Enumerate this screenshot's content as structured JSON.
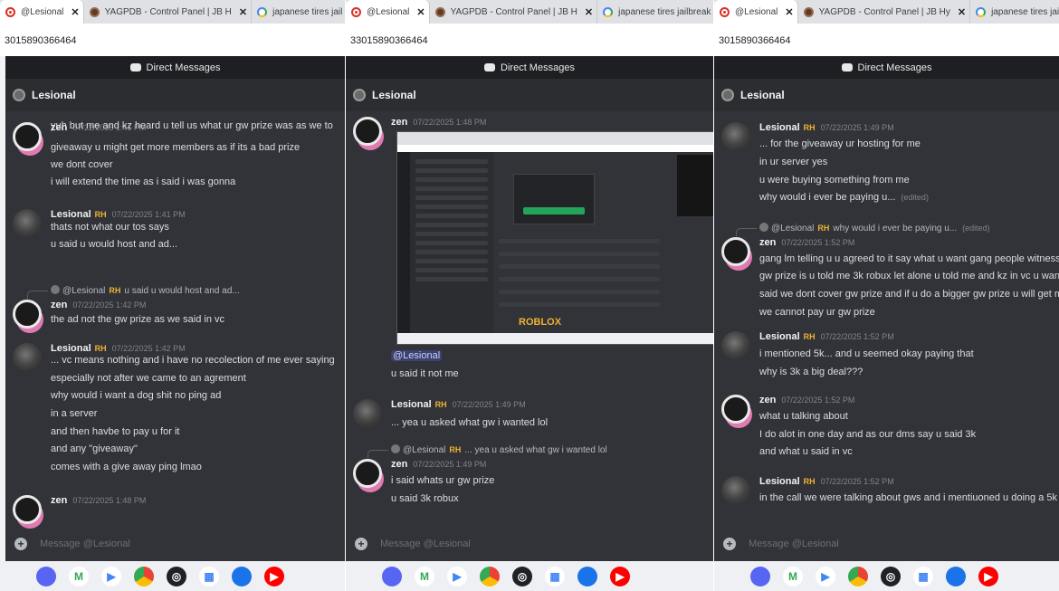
{
  "panels": [
    {
      "tabs": [
        "@Lesional",
        "YAGPDB - Control Panel | JB H",
        "japanese tires jail"
      ],
      "url": "3015890366464",
      "header": "Direct Messages",
      "channel": "Lesional",
      "messages": [
        {
          "user": "zen",
          "ts": "07/22/2025 1:41 PM",
          "lines": [
            "yuh but me and kz heard u tell us what ur gw prize was as we to",
            "giveaway u might get more members as if its a bad prize",
            "we dont cover",
            "i will extend the time as i said i was gonna"
          ]
        },
        {
          "user": "Lesional",
          "badge": "RH",
          "ts": "07/22/2025 1:41 PM",
          "lines": [
            "thats not what our tos says",
            "u said u would host and ad..."
          ]
        },
        {
          "reply": {
            "user": "@Lesional",
            "badge": "RH",
            "text": "u said u would host and ad..."
          },
          "user": "zen",
          "ts": "07/22/2025 1:42 PM",
          "lines": [
            "the ad not the gw prize as we said in vc"
          ]
        },
        {
          "user": "Lesional",
          "badge": "RH",
          "ts": "07/22/2025 1:42 PM",
          "lines": [
            "... vc means nothing and i have no recolection of me ever saying",
            "especially not after we came to an agrement",
            "why would i want a dog shit no ping ad",
            "in a server",
            "and then havbe to pay u for it",
            "and any \"giveaway\"",
            "comes with a give away ping lmao"
          ]
        },
        {
          "user": "zen",
          "ts": "07/22/2025 1:48 PM",
          "lines": []
        }
      ],
      "composer": "Message @Lesional"
    },
    {
      "tabs": [
        "@Lesional",
        "YAGPDB - Control Panel | JB H",
        "japanese tires jailbreak"
      ],
      "url": "33015890366464",
      "header": "Direct Messages",
      "channel": "Lesional",
      "messages": [
        {
          "user": "zen",
          "ts": "07/22/2025 1:48 PM",
          "image_text": "ROBLOX",
          "mention": "@Lesional",
          "lines": [
            "u said it not me"
          ]
        },
        {
          "user": "Lesional",
          "badge": "RH",
          "ts": "07/22/2025 1:49 PM",
          "lines": [
            "... yea u asked what gw i wanted lol"
          ]
        },
        {
          "reply": {
            "user": "@Lesional",
            "badge": "RH",
            "text": "... yea u asked what gw i wanted lol"
          },
          "user": "zen",
          "ts": "07/22/2025 1:49 PM",
          "lines": [
            "i said whats ur gw prize",
            "u said 3k robux"
          ]
        }
      ],
      "composer": "Message @Lesional"
    },
    {
      "tabs": [
        "@Lesional",
        "YAGPDB - Control Panel | JB Hy",
        "japanese tires jailbreak"
      ],
      "url": "3015890366464",
      "header": "Direct Messages",
      "channel": "Lesional",
      "messages": [
        {
          "user": "Lesional",
          "badge": "RH",
          "ts": "07/22/2025 1:49 PM",
          "lines": [
            "... for the giveaway ur hosting for me",
            "in ur server yes",
            "u were buying something from me",
            "why would i ever be paying u..."
          ],
          "edited": "(edited)"
        },
        {
          "reply": {
            "user": "@Lesional",
            "badge": "RH",
            "text": "why would i ever be paying u...",
            "edited": "(edited)"
          },
          "user": "zen",
          "ts": "07/22/2025 1:52 PM",
          "lines": [
            "gang lm telling u u agreed to it say what u want gang people witness",
            "gw prize is u told me 3k robux let alone u told me and kz in vc u wan",
            "said we dont cover gw prize and if u do a bigger gw prize u will get m",
            "we cannot pay ur gw prize"
          ]
        },
        {
          "user": "Lesional",
          "badge": "RH",
          "ts": "07/22/2025 1:52 PM",
          "lines": [
            "i mentioned 5k... and u seemed okay paying that",
            "why is 3k a big deal???"
          ]
        },
        {
          "user": "zen",
          "ts": "07/22/2025 1:52 PM",
          "lines": [
            "what u talking about",
            "I do alot in one day and as our dms say u said 3k",
            "and what u said in vc"
          ]
        },
        {
          "user": "Lesional",
          "badge": "RH",
          "ts": "07/22/2025 1:52 PM",
          "lines": [
            "in the call we were talking about gws and i mentiuoned u doing a 5k"
          ]
        }
      ],
      "composer": "Message @Lesional"
    }
  ],
  "shelf_icons": [
    "discord-icon",
    "gmail-icon",
    "play-store-icon",
    "chrome-icon",
    "ai-assistant-icon",
    "calendar-icon",
    "files-icon",
    "youtube-icon"
  ],
  "colors": {
    "discord_bg": "#313338",
    "header_bg": "#1e1f22",
    "username": "#f2f3f5",
    "badge": "#f0b232",
    "mention": "#c9cdfb"
  }
}
